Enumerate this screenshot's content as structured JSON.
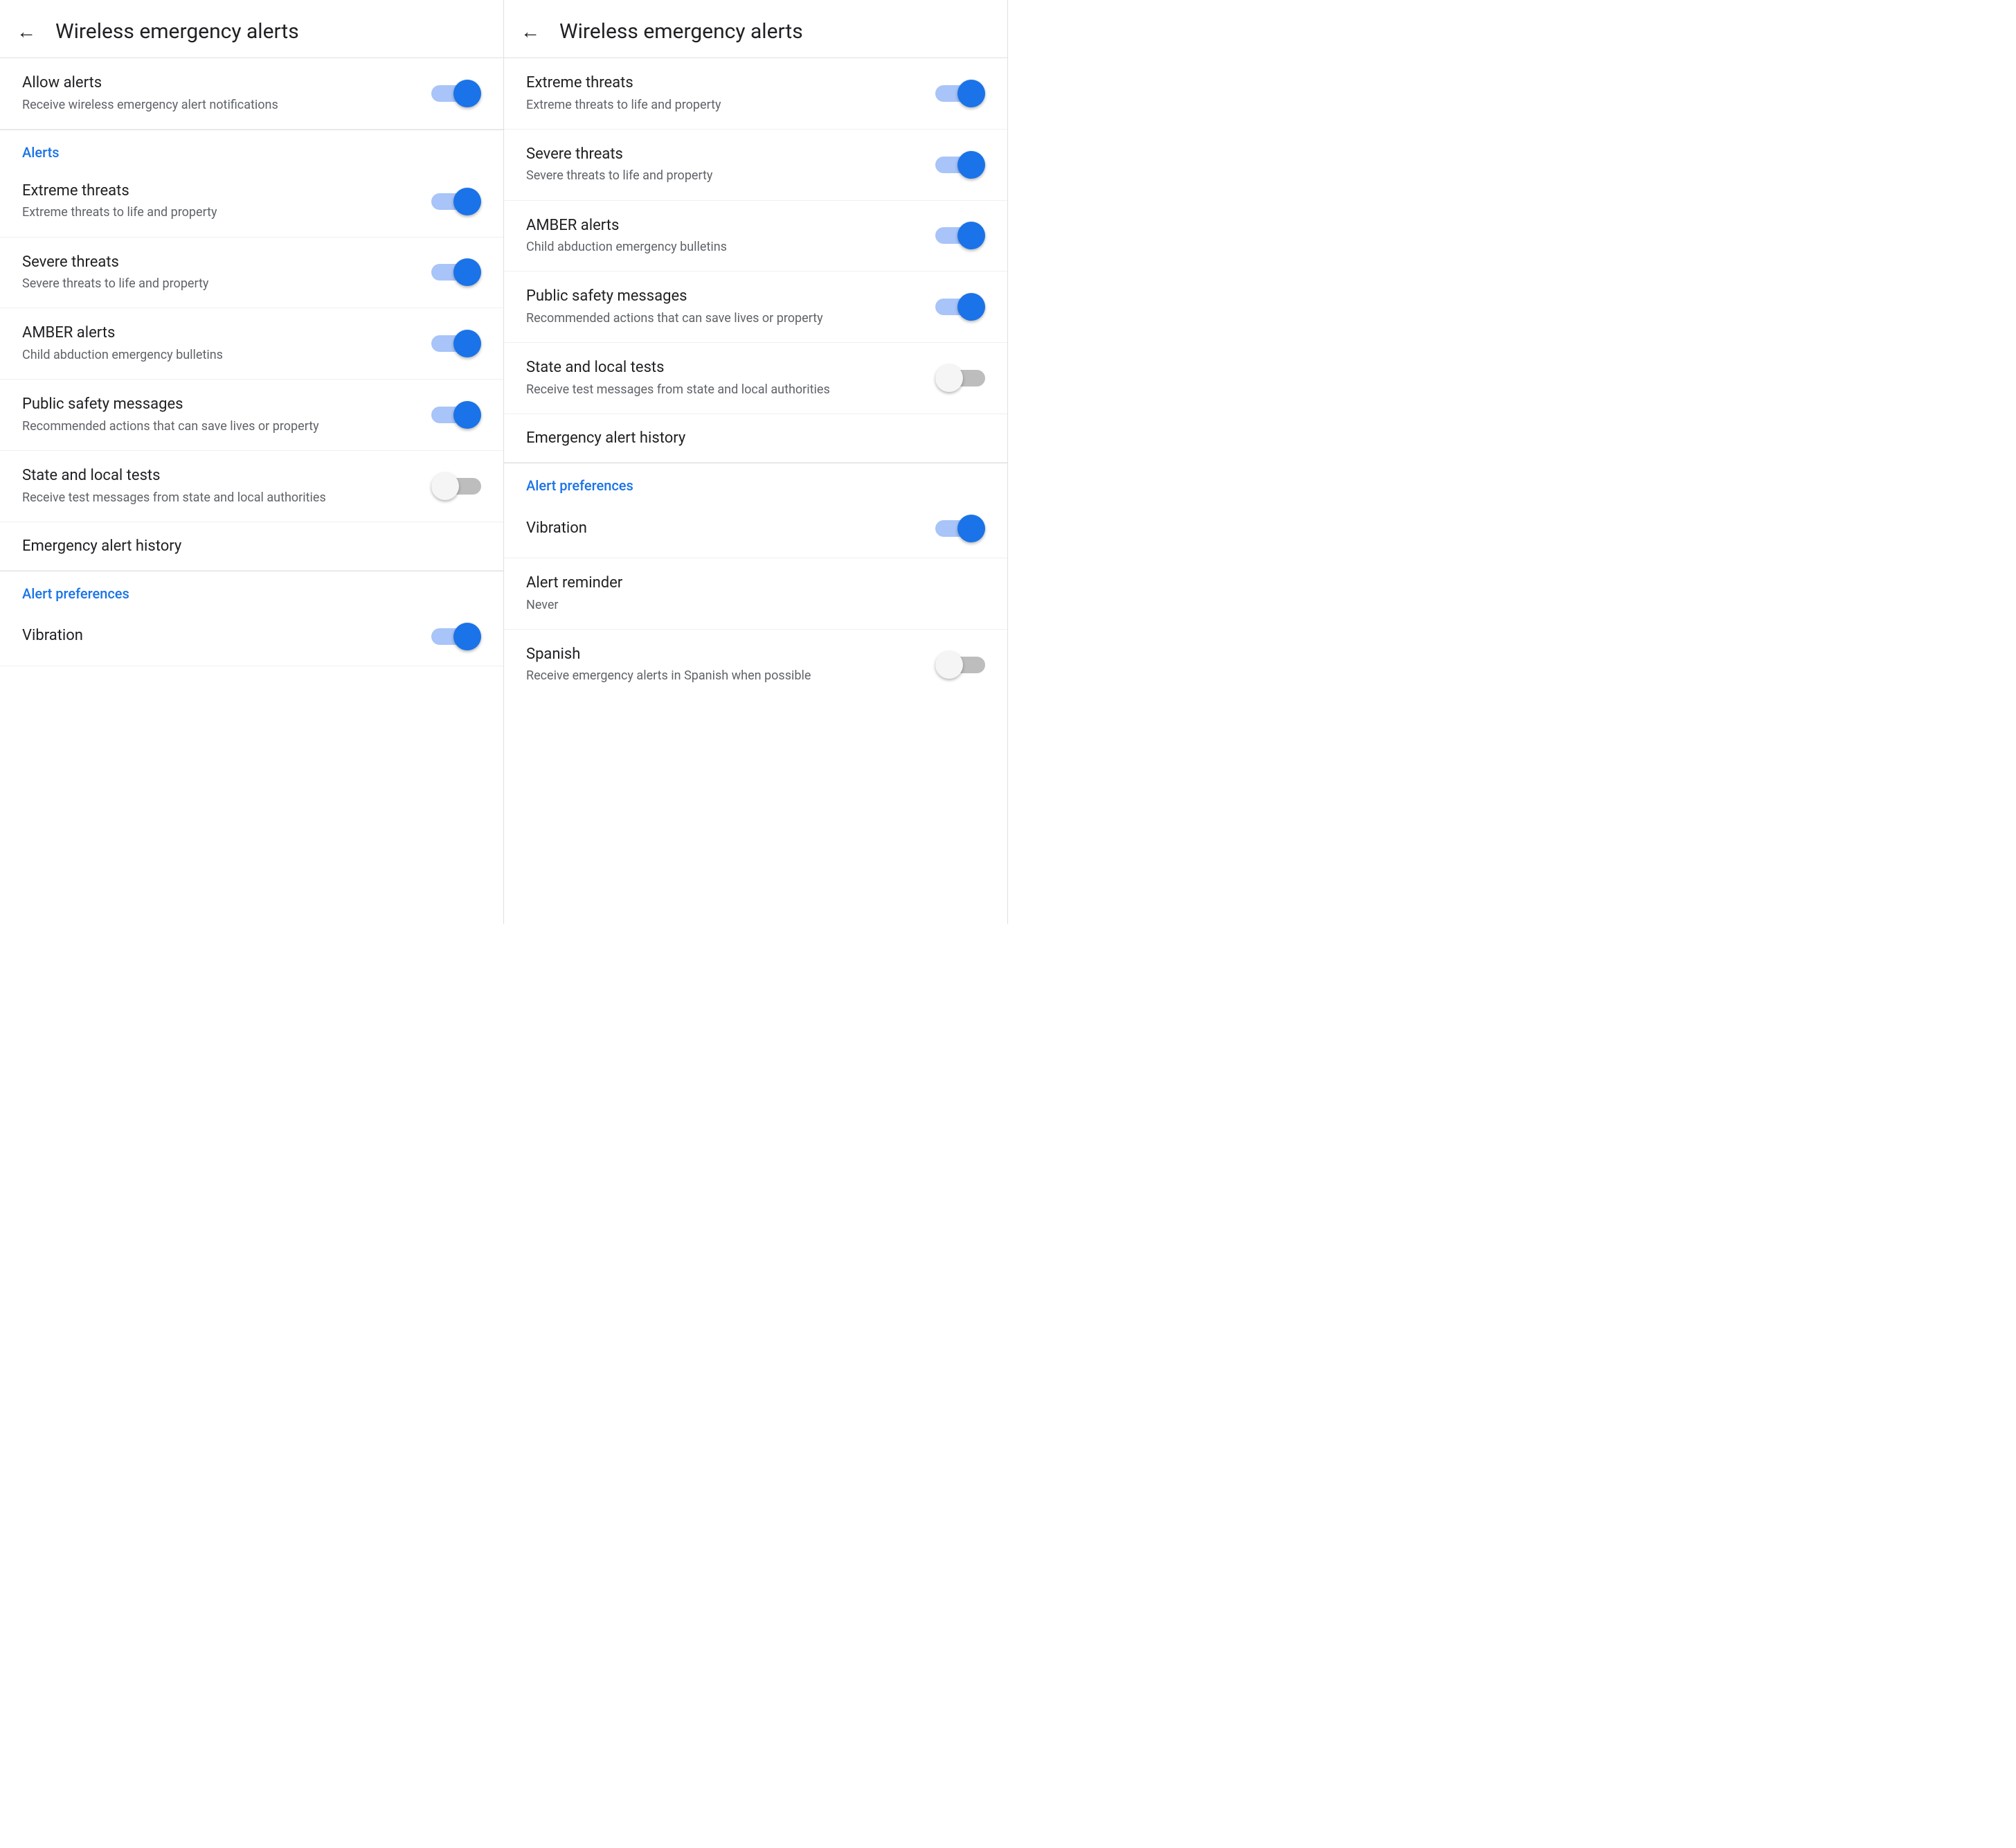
{
  "panel1": {
    "header": {
      "back_label": "←",
      "title": "Wireless emergency alerts"
    },
    "items": [
      {
        "id": "allow-alerts",
        "title": "Allow alerts",
        "subtitle": "Receive wireless emergency alert notifications",
        "toggle": true,
        "has_toggle": true,
        "section": null
      }
    ],
    "section_alerts_label": "Alerts",
    "alerts_items": [
      {
        "id": "extreme-threats",
        "title": "Extreme threats",
        "subtitle": "Extreme threats to life and property",
        "toggle": true,
        "has_toggle": true
      },
      {
        "id": "severe-threats",
        "title": "Severe threats",
        "subtitle": "Severe threats to life and property",
        "toggle": true,
        "has_toggle": true
      },
      {
        "id": "amber-alerts",
        "title": "AMBER alerts",
        "subtitle": "Child abduction emergency bulletins",
        "toggle": true,
        "has_toggle": true
      },
      {
        "id": "public-safety",
        "title": "Public safety messages",
        "subtitle": "Recommended actions that can save lives or property",
        "toggle": true,
        "has_toggle": true
      },
      {
        "id": "state-local-tests",
        "title": "State and local tests",
        "subtitle": "Receive test messages from state and local authorities",
        "toggle": false,
        "has_toggle": true
      }
    ],
    "emergency_history_label": "Emergency alert history",
    "section_preferences_label": "Alert preferences",
    "preferences_items": [
      {
        "id": "vibration",
        "title": "Vibration",
        "subtitle": "",
        "toggle": true,
        "has_toggle": true
      }
    ]
  },
  "panel2": {
    "header": {
      "back_label": "←",
      "title": "Wireless emergency alerts"
    },
    "alerts_items": [
      {
        "id": "extreme-threats-2",
        "title": "Extreme threats",
        "subtitle": "Extreme threats to life and property",
        "toggle": true,
        "has_toggle": true
      },
      {
        "id": "severe-threats-2",
        "title": "Severe threats",
        "subtitle": "Severe threats to life and property",
        "toggle": true,
        "has_toggle": true
      },
      {
        "id": "amber-alerts-2",
        "title": "AMBER alerts",
        "subtitle": "Child abduction emergency bulletins",
        "toggle": true,
        "has_toggle": true
      },
      {
        "id": "public-safety-2",
        "title": "Public safety messages",
        "subtitle": "Recommended actions that can save lives or property",
        "toggle": true,
        "has_toggle": true
      },
      {
        "id": "state-local-tests-2",
        "title": "State and local tests",
        "subtitle": "Receive test messages from state and local authorities",
        "toggle": false,
        "has_toggle": true
      }
    ],
    "emergency_history_label": "Emergency alert history",
    "section_preferences_label": "Alert preferences",
    "preferences_items": [
      {
        "id": "vibration-2",
        "title": "Vibration",
        "subtitle": "",
        "toggle": true,
        "has_toggle": true
      },
      {
        "id": "alert-reminder",
        "title": "Alert reminder",
        "subtitle": "Never",
        "toggle": null,
        "has_toggle": false
      },
      {
        "id": "spanish",
        "title": "Spanish",
        "subtitle": "Receive emergency alerts in Spanish when possible",
        "toggle": false,
        "has_toggle": true
      }
    ]
  }
}
